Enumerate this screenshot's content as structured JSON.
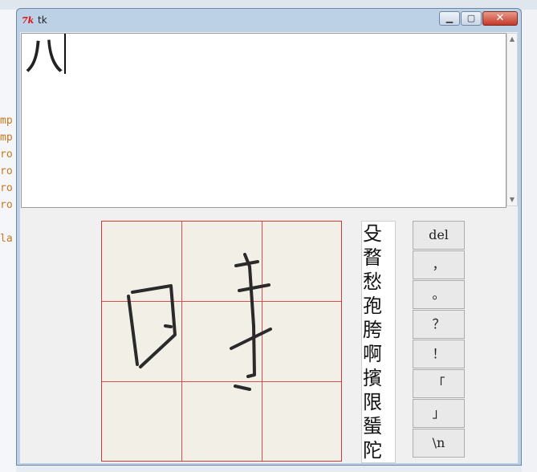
{
  "window": {
    "title": "tk"
  },
  "textbox": {
    "content": "八"
  },
  "candidates": [
    "殳",
    "瞀",
    "愁",
    "孢",
    "胯",
    "啊",
    "擯",
    "限",
    "蜑",
    "陀"
  ],
  "buttons": [
    "del",
    "，",
    "。",
    "？",
    "！",
    "「",
    "」",
    "\\n"
  ],
  "background": {
    "code_fragments": [
      "mp",
      "mp",
      "ro",
      "ro",
      "ro",
      "ro",
      "la"
    ]
  }
}
